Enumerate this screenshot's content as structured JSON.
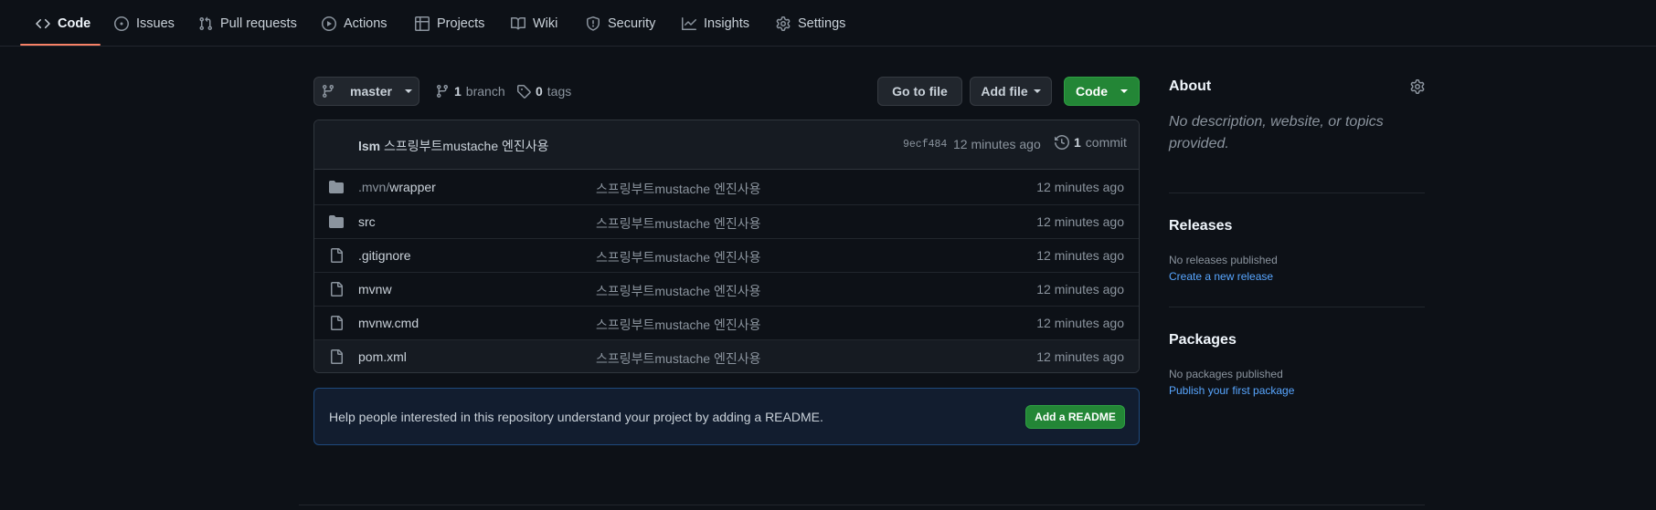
{
  "nav": {
    "tabs": [
      {
        "label": "Code",
        "icon": "code-icon"
      },
      {
        "label": "Issues",
        "icon": "issue-opened-icon"
      },
      {
        "label": "Pull requests",
        "icon": "git-pull-request-icon"
      },
      {
        "label": "Actions",
        "icon": "play-icon"
      },
      {
        "label": "Projects",
        "icon": "table-icon"
      },
      {
        "label": "Wiki",
        "icon": "book-icon"
      },
      {
        "label": "Security",
        "icon": "shield-icon"
      },
      {
        "label": "Insights",
        "icon": "graph-icon"
      },
      {
        "label": "Settings",
        "icon": "gear-icon"
      }
    ],
    "selected": "Code",
    "underline_color": "#f78166"
  },
  "toolbar": {
    "branch_name": "master",
    "branch_count": "1",
    "branch_label": "branch",
    "tag_count": "0",
    "tag_label": "tags",
    "go_to_file": "Go to file",
    "add_file": "Add file",
    "code": "Code"
  },
  "commit": {
    "author": "lsm",
    "message": "스프링부트mustache 엔진사용",
    "sha": "9ecf484",
    "time": "12 minutes ago",
    "count": "1",
    "count_label": "commit"
  },
  "files": [
    {
      "type": "folder",
      "name_prefix": ".mvn/",
      "name": "wrapper",
      "message": "스프링부트mustache 엔진사용",
      "time": "12 minutes ago"
    },
    {
      "type": "folder",
      "name_prefix": "",
      "name": "src",
      "message": "스프링부트mustache 엔진사용",
      "time": "12 minutes ago"
    },
    {
      "type": "file",
      "name_prefix": "",
      "name": ".gitignore",
      "message": "스프링부트mustache 엔진사용",
      "time": "12 minutes ago"
    },
    {
      "type": "file",
      "name_prefix": "",
      "name": "mvnw",
      "message": "스프링부트mustache 엔진사용",
      "time": "12 minutes ago"
    },
    {
      "type": "file",
      "name_prefix": "",
      "name": "mvnw.cmd",
      "message": "스프링부트mustache 엔진사용",
      "time": "12 minutes ago"
    },
    {
      "type": "file",
      "name_prefix": "",
      "name": "pom.xml",
      "message": "스프링부트mustache 엔진사용",
      "time": "12 minutes ago"
    }
  ],
  "readme": {
    "text": "Help people interested in this repository understand your project by adding a README.",
    "button": "Add a README"
  },
  "sidebar": {
    "about_title": "About",
    "about_desc": "No description, website, or topics provided.",
    "releases_title": "Releases",
    "releases_empty": "No releases published",
    "releases_link": "Create a new release",
    "packages_title": "Packages",
    "packages_empty": "No packages published",
    "packages_link": "Publish your first package"
  },
  "colors": {
    "background": "#0d1117",
    "accent_green": "#238636",
    "link_blue": "#58a6ff",
    "readme_bg": "#121d2f"
  }
}
